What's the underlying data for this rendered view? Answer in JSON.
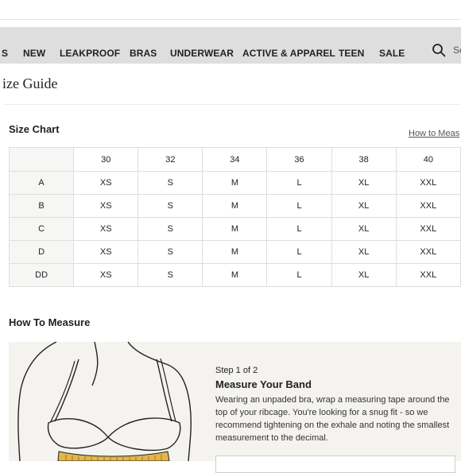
{
  "nav": {
    "items": [
      "S",
      "NEW",
      "LEAKPROOF",
      "BRAS",
      "UNDERWEAR",
      "ACTIVE & APPAREL",
      "TEEN",
      "SALE"
    ],
    "search_text": "Se"
  },
  "page": {
    "title": "ize Guide"
  },
  "size_chart": {
    "heading": "Size Chart",
    "measure_link": "How to Meas",
    "band_sizes": [
      "30",
      "32",
      "34",
      "36",
      "38",
      "40"
    ],
    "rows": [
      {
        "cup": "A",
        "sizes": [
          "XS",
          "S",
          "M",
          "L",
          "XL",
          "XXL"
        ]
      },
      {
        "cup": "B",
        "sizes": [
          "XS",
          "S",
          "M",
          "L",
          "XL",
          "XXL"
        ]
      },
      {
        "cup": "C",
        "sizes": [
          "XS",
          "S",
          "M",
          "L",
          "XL",
          "XXL"
        ]
      },
      {
        "cup": "D",
        "sizes": [
          "XS",
          "S",
          "M",
          "L",
          "XL",
          "XXL"
        ]
      },
      {
        "cup": "DD",
        "sizes": [
          "XS",
          "S",
          "M",
          "L",
          "XL",
          "XXL"
        ]
      }
    ]
  },
  "how_to_measure": {
    "heading": "How To Measure",
    "step": "Step 1 of 2",
    "step_title": "Measure Your Band",
    "description": "Wearing an unpaded bra, wrap a measuring tape around the top of your ribcage. You're looking for a snug fit - so we recommend tightening on the exhale and noting the smallest measurement to the decimal."
  },
  "colors": {
    "nav_bg": "#dededf",
    "panel_bg": "#f4f3ef",
    "tape": "#e3b64a"
  },
  "icons": {
    "search": "search-icon"
  }
}
